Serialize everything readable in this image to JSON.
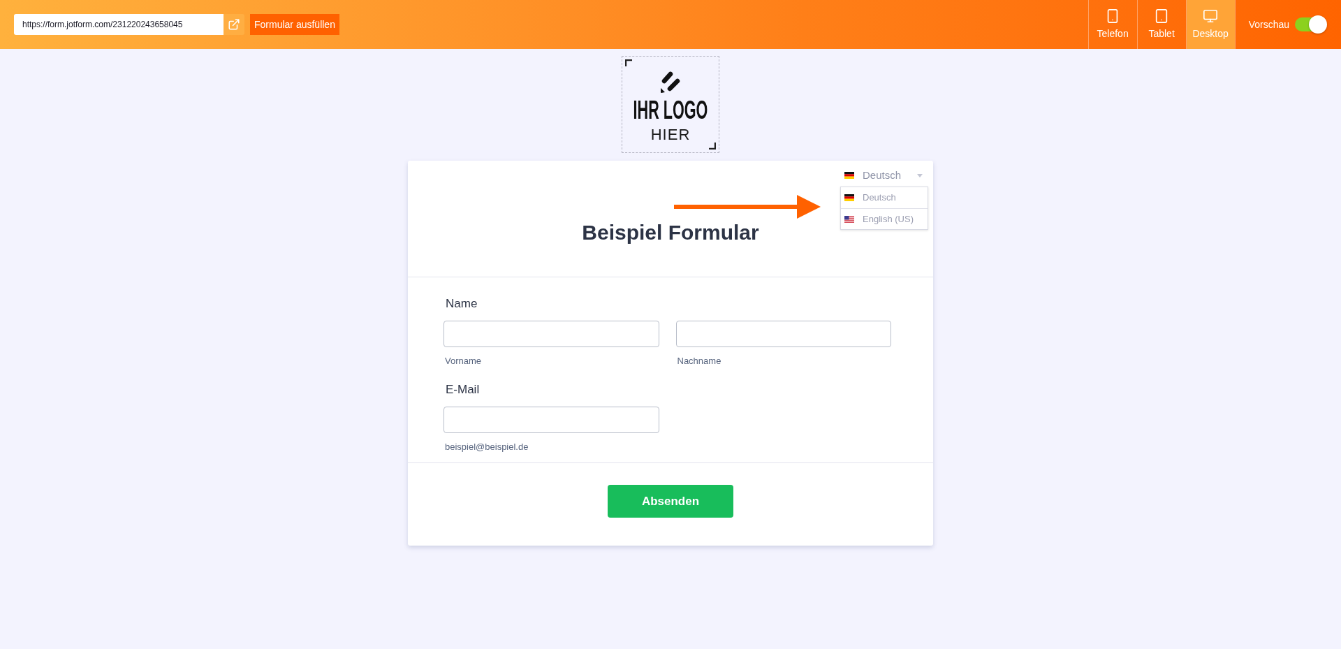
{
  "toolbar": {
    "url": "https://form.jotform.com/231220243658045",
    "fill_button": "Formular ausfüllen",
    "devices": [
      {
        "label": "Telefon",
        "kind": "phone",
        "selected": false
      },
      {
        "label": "Tablet",
        "kind": "tablet",
        "selected": false
      },
      {
        "label": "Desktop",
        "kind": "desktop",
        "selected": true
      }
    ],
    "preview": {
      "label": "Vorschau",
      "on": true
    }
  },
  "logo": {
    "line_1": "IHR LOGO",
    "line_2": "HIER"
  },
  "form": {
    "language": {
      "value": "Deutsch",
      "kind": "german",
      "expanded": true,
      "options": [
        {
          "label": "Deutsch",
          "kind": "german"
        },
        {
          "label": "English (US)",
          "kind": "american"
        }
      ]
    },
    "title": "Beispiel Formular",
    "fields": [
      {
        "label": "Name",
        "inputs": [
          {
            "sublabel": "Vorname"
          },
          {
            "sublabel": "Nachname"
          }
        ]
      },
      {
        "label": "E-Mail",
        "inputs": [
          {
            "sublabel": "beispiel@beispiel.de"
          }
        ]
      }
    ],
    "submit": "Absenden"
  }
}
